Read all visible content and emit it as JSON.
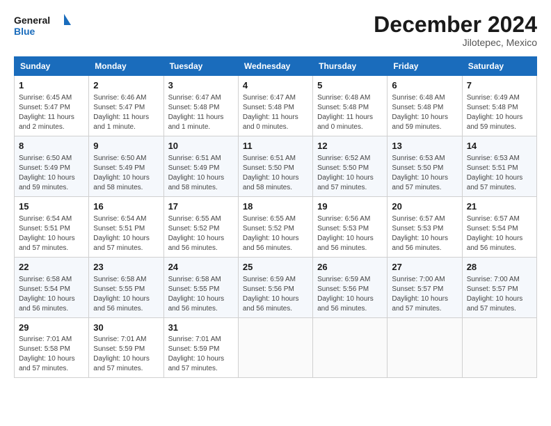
{
  "logo": {
    "text_general": "General",
    "text_blue": "Blue"
  },
  "header": {
    "month": "December 2024",
    "location": "Jilotepec, Mexico"
  },
  "weekdays": [
    "Sunday",
    "Monday",
    "Tuesday",
    "Wednesday",
    "Thursday",
    "Friday",
    "Saturday"
  ],
  "weeks": [
    [
      {
        "day": "1",
        "info": "Sunrise: 6:45 AM\nSunset: 5:47 PM\nDaylight: 11 hours\nand 2 minutes."
      },
      {
        "day": "2",
        "info": "Sunrise: 6:46 AM\nSunset: 5:47 PM\nDaylight: 11 hours\nand 1 minute."
      },
      {
        "day": "3",
        "info": "Sunrise: 6:47 AM\nSunset: 5:48 PM\nDaylight: 11 hours\nand 1 minute."
      },
      {
        "day": "4",
        "info": "Sunrise: 6:47 AM\nSunset: 5:48 PM\nDaylight: 11 hours\nand 0 minutes."
      },
      {
        "day": "5",
        "info": "Sunrise: 6:48 AM\nSunset: 5:48 PM\nDaylight: 11 hours\nand 0 minutes."
      },
      {
        "day": "6",
        "info": "Sunrise: 6:48 AM\nSunset: 5:48 PM\nDaylight: 10 hours\nand 59 minutes."
      },
      {
        "day": "7",
        "info": "Sunrise: 6:49 AM\nSunset: 5:48 PM\nDaylight: 10 hours\nand 59 minutes."
      }
    ],
    [
      {
        "day": "8",
        "info": "Sunrise: 6:50 AM\nSunset: 5:49 PM\nDaylight: 10 hours\nand 59 minutes."
      },
      {
        "day": "9",
        "info": "Sunrise: 6:50 AM\nSunset: 5:49 PM\nDaylight: 10 hours\nand 58 minutes."
      },
      {
        "day": "10",
        "info": "Sunrise: 6:51 AM\nSunset: 5:49 PM\nDaylight: 10 hours\nand 58 minutes."
      },
      {
        "day": "11",
        "info": "Sunrise: 6:51 AM\nSunset: 5:50 PM\nDaylight: 10 hours\nand 58 minutes."
      },
      {
        "day": "12",
        "info": "Sunrise: 6:52 AM\nSunset: 5:50 PM\nDaylight: 10 hours\nand 57 minutes."
      },
      {
        "day": "13",
        "info": "Sunrise: 6:53 AM\nSunset: 5:50 PM\nDaylight: 10 hours\nand 57 minutes."
      },
      {
        "day": "14",
        "info": "Sunrise: 6:53 AM\nSunset: 5:51 PM\nDaylight: 10 hours\nand 57 minutes."
      }
    ],
    [
      {
        "day": "15",
        "info": "Sunrise: 6:54 AM\nSunset: 5:51 PM\nDaylight: 10 hours\nand 57 minutes."
      },
      {
        "day": "16",
        "info": "Sunrise: 6:54 AM\nSunset: 5:51 PM\nDaylight: 10 hours\nand 57 minutes."
      },
      {
        "day": "17",
        "info": "Sunrise: 6:55 AM\nSunset: 5:52 PM\nDaylight: 10 hours\nand 56 minutes."
      },
      {
        "day": "18",
        "info": "Sunrise: 6:55 AM\nSunset: 5:52 PM\nDaylight: 10 hours\nand 56 minutes."
      },
      {
        "day": "19",
        "info": "Sunrise: 6:56 AM\nSunset: 5:53 PM\nDaylight: 10 hours\nand 56 minutes."
      },
      {
        "day": "20",
        "info": "Sunrise: 6:57 AM\nSunset: 5:53 PM\nDaylight: 10 hours\nand 56 minutes."
      },
      {
        "day": "21",
        "info": "Sunrise: 6:57 AM\nSunset: 5:54 PM\nDaylight: 10 hours\nand 56 minutes."
      }
    ],
    [
      {
        "day": "22",
        "info": "Sunrise: 6:58 AM\nSunset: 5:54 PM\nDaylight: 10 hours\nand 56 minutes."
      },
      {
        "day": "23",
        "info": "Sunrise: 6:58 AM\nSunset: 5:55 PM\nDaylight: 10 hours\nand 56 minutes."
      },
      {
        "day": "24",
        "info": "Sunrise: 6:58 AM\nSunset: 5:55 PM\nDaylight: 10 hours\nand 56 minutes."
      },
      {
        "day": "25",
        "info": "Sunrise: 6:59 AM\nSunset: 5:56 PM\nDaylight: 10 hours\nand 56 minutes."
      },
      {
        "day": "26",
        "info": "Sunrise: 6:59 AM\nSunset: 5:56 PM\nDaylight: 10 hours\nand 56 minutes."
      },
      {
        "day": "27",
        "info": "Sunrise: 7:00 AM\nSunset: 5:57 PM\nDaylight: 10 hours\nand 57 minutes."
      },
      {
        "day": "28",
        "info": "Sunrise: 7:00 AM\nSunset: 5:57 PM\nDaylight: 10 hours\nand 57 minutes."
      }
    ],
    [
      {
        "day": "29",
        "info": "Sunrise: 7:01 AM\nSunset: 5:58 PM\nDaylight: 10 hours\nand 57 minutes."
      },
      {
        "day": "30",
        "info": "Sunrise: 7:01 AM\nSunset: 5:59 PM\nDaylight: 10 hours\nand 57 minutes."
      },
      {
        "day": "31",
        "info": "Sunrise: 7:01 AM\nSunset: 5:59 PM\nDaylight: 10 hours\nand 57 minutes."
      },
      null,
      null,
      null,
      null
    ]
  ]
}
